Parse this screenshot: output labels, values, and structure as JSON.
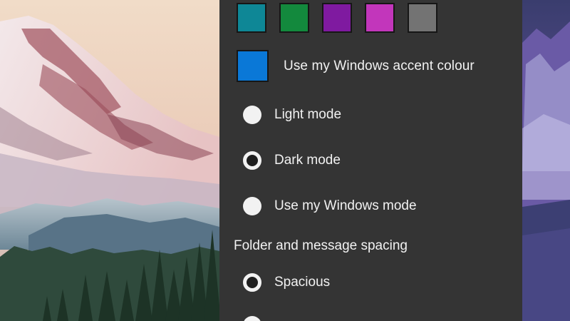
{
  "theme": {
    "swatches": [
      {
        "name": "teal",
        "color": "#0e8796"
      },
      {
        "name": "green",
        "color": "#13893d"
      },
      {
        "name": "purple",
        "color": "#7f1aa0"
      },
      {
        "name": "magenta",
        "color": "#c236bb"
      },
      {
        "name": "gray",
        "color": "#737373"
      }
    ],
    "accent": {
      "label": "Use my Windows accent colour",
      "color": "#0a78d7"
    },
    "modes": [
      {
        "label": "Light mode",
        "selected": false
      },
      {
        "label": "Dark mode",
        "selected": true
      },
      {
        "label": "Use my Windows mode",
        "selected": false
      }
    ]
  },
  "spacing": {
    "title": "Folder and message spacing",
    "options": [
      {
        "label": "Spacious",
        "selected": true
      },
      {
        "label": "",
        "selected": false
      }
    ]
  },
  "colors": {
    "panel_bg": "#343434",
    "text": "#f2f2f2",
    "radio_fill": "#f2f2f2"
  }
}
